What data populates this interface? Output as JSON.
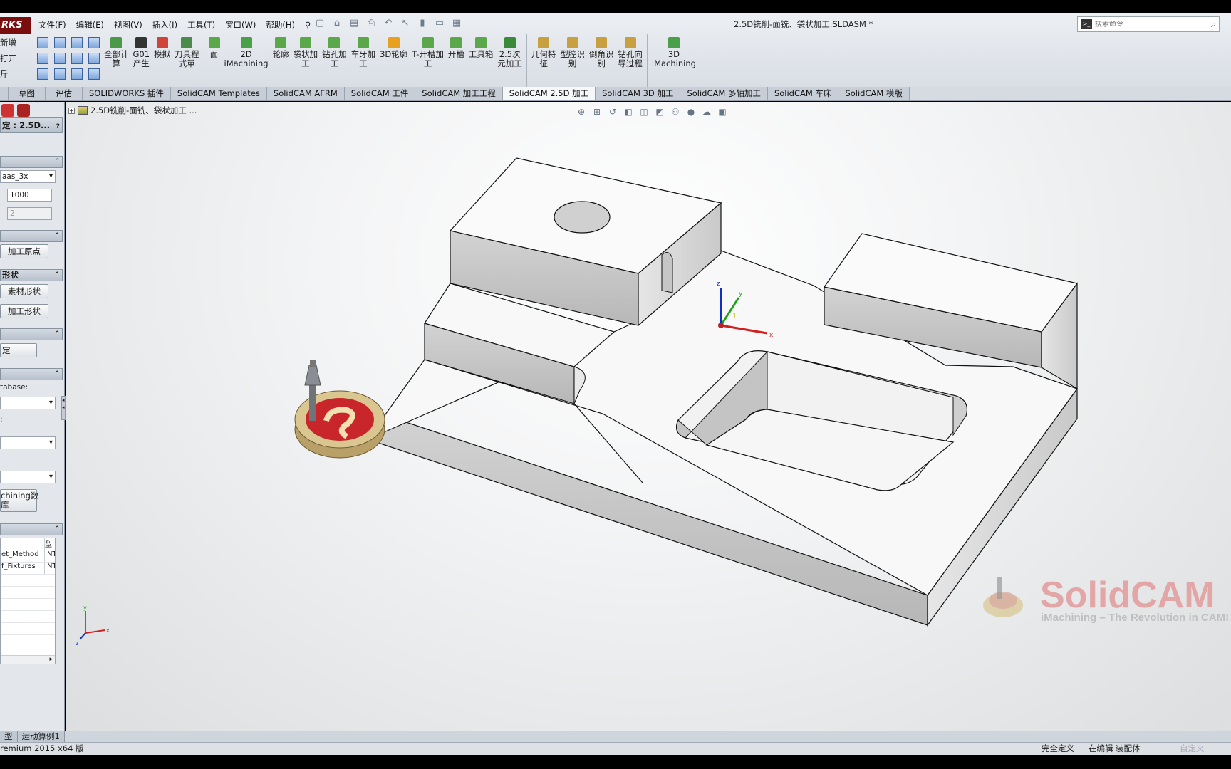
{
  "app": {
    "brand": "RKS",
    "doc_title": "2.5D铣削-面铣、袋状加工.SLDASM *"
  },
  "menu": [
    "文件(F)",
    "编辑(E)",
    "视图(V)",
    "插入(I)",
    "工具(T)",
    "窗口(W)",
    "帮助(H)"
  ],
  "search": {
    "placeholder": "搜索命令"
  },
  "ribbon_left": {
    "new_label": "新增",
    "open_label": "打开",
    "close_label": "斤"
  },
  "ribbon": [
    {
      "label": "全部计\n算",
      "icon": "calculator-icon",
      "color": "#4a9a4a"
    },
    {
      "label": "G01\n产生",
      "icon": "gcode-icon",
      "color": "#333333"
    },
    {
      "label": "模拟",
      "icon": "simulate-icon",
      "color": "#d0453a"
    },
    {
      "label": "刀具程\n式單",
      "icon": "toolsheet-icon",
      "color": "#4a8a4a"
    },
    {
      "label": "面",
      "icon": "face-icon",
      "color": "#5aa84a"
    },
    {
      "label": "2D\niMachining",
      "icon": "imachining2d-icon",
      "color": "#4aa04a"
    },
    {
      "label": "轮廓",
      "icon": "profile-icon",
      "color": "#5aa84a"
    },
    {
      "label": "袋状加\n工",
      "icon": "pocket-icon",
      "color": "#5aa84a"
    },
    {
      "label": "钻孔加\n工",
      "icon": "drill-icon",
      "color": "#5aa84a"
    },
    {
      "label": "车牙加\n工",
      "icon": "thread-icon",
      "color": "#5aa84a"
    },
    {
      "label": "3D轮廓",
      "icon": "profile3d-icon",
      "color": "#e8a020"
    },
    {
      "label": "T-开槽加\n工",
      "icon": "tslot-icon",
      "color": "#5aa84a"
    },
    {
      "label": "开槽",
      "icon": "slot-icon",
      "color": "#5aa84a"
    },
    {
      "label": "工具箱",
      "icon": "toolbox-icon",
      "color": "#5aa84a"
    },
    {
      "label": "2.5次\n元加工",
      "icon": "2_5d-icon",
      "color": "#3a8a3a"
    },
    {
      "label": "几何特\n征",
      "icon": "geometry-icon",
      "color": "#c8a040"
    },
    {
      "label": "型腔识\n别",
      "icon": "cavity-icon",
      "color": "#c8a040"
    },
    {
      "label": "倒角识\n别",
      "icon": "chamfer-icon",
      "color": "#c8a040"
    },
    {
      "label": "钻孔向\n导过程",
      "icon": "drillwizard-icon",
      "color": "#c8a040"
    },
    {
      "label": "3D\niMachining",
      "icon": "imachining3d-icon",
      "color": "#4aa04a"
    }
  ],
  "tabs": [
    "草图",
    "评估",
    "SOLIDWORKS 插件",
    "SolidCAM Templates",
    "SolidCAM AFRM",
    "SolidCAM 工件",
    "SolidCAM 加工工程",
    "SolidCAM 2.5D 加工",
    "SolidCAM 3D 加工",
    "SolidCAM 多轴加工",
    "SolidCAM 车床",
    "SolidCAM 模版"
  ],
  "active_tab": "SolidCAM 2.5D 加工",
  "panel": {
    "title": "定 : 2.5D...",
    "machine_select": "aas_3x",
    "input_value": "1000",
    "input_disabled": "2",
    "origin_button": "加工原点",
    "shape_header": "形状",
    "stock_button": "素材形状",
    "target_button": "加工形状",
    "settings_button": "定",
    "database_label": "tabase:",
    "colon_label": ":",
    "imachining_button": "chining数\n库",
    "table_header_col2": "型",
    "table_rows": [
      {
        "name": "et_Method",
        "type": "INT"
      },
      {
        "name": "f_Fixtures",
        "type": "INT"
      }
    ]
  },
  "tree_root": "2.5D铣削-面铣、袋状加工 ...",
  "bottom_tabs": [
    "型",
    "运动算例1"
  ],
  "status": {
    "left": "remium 2015 x64 版",
    "definition": "完全定义",
    "editing": "在编辑 装配体",
    "custom": "自定义"
  },
  "watermark": {
    "brand": "SolidCAM",
    "tagline": "iMachining – The Revolution in CAM!"
  },
  "triad_labels": {
    "x": "x",
    "y": "y",
    "z": "z",
    "one": "1"
  },
  "colors": {
    "accent_red": "#c0392b",
    "ribbon_bg": "#dfe3e8",
    "brand_red": "#7a0d0d"
  }
}
